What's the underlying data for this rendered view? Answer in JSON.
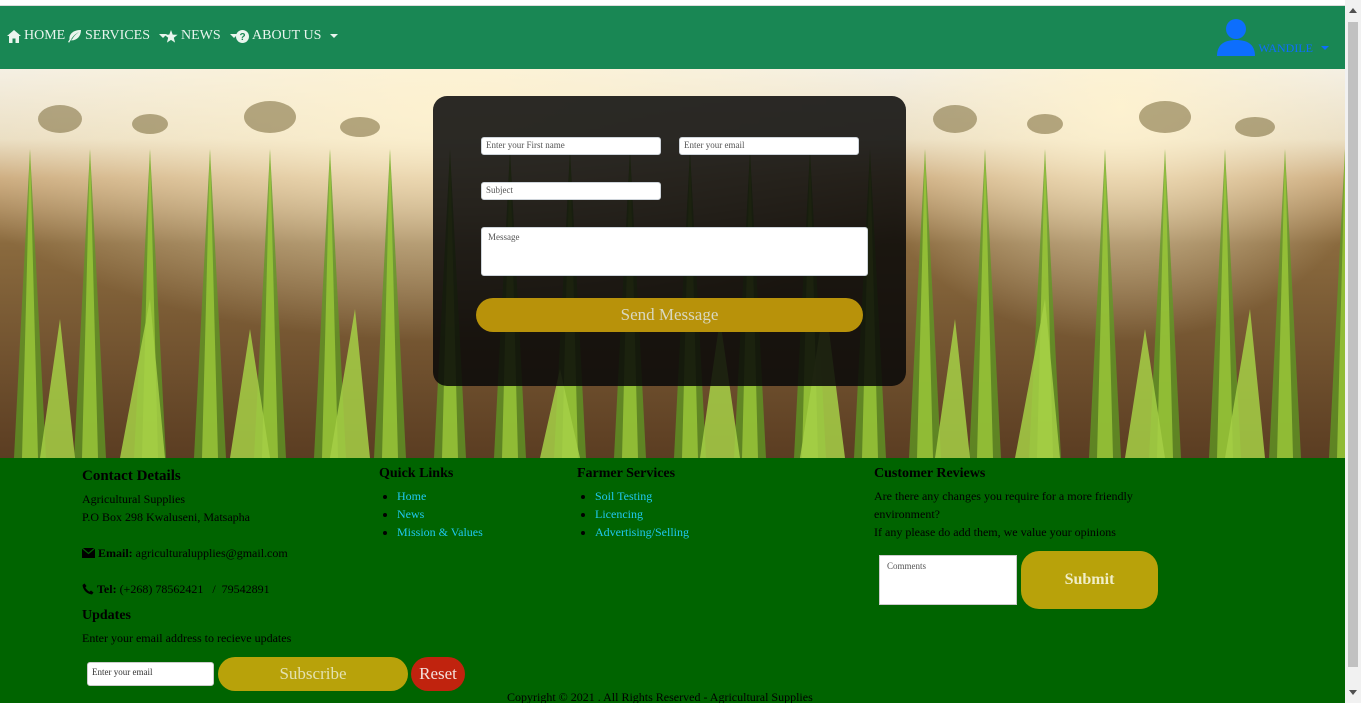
{
  "nav": {
    "items": [
      {
        "label": "HOME",
        "icon": "home-icon"
      },
      {
        "label": "SERVICES",
        "icon": "leaf-icon"
      },
      {
        "label": "NEWS",
        "icon": "star-icon"
      },
      {
        "label": "ABOUT US",
        "icon": "question-circle-icon"
      }
    ],
    "user": {
      "name": "WANDILE",
      "icon": "user-icon"
    }
  },
  "contact_form": {
    "first_name_placeholder": "Enter your First name",
    "email_placeholder": "Enter your email",
    "subject_placeholder": "Subject",
    "message_placeholder": "Message",
    "send_label": "Send Message"
  },
  "footer": {
    "contact": {
      "title": "Contact Details",
      "line1": "Agricultural Supplies",
      "line2": "P.O Box 298 Kwaluseni, Matsapha",
      "email_label": "Email:",
      "email": "agriculturalupplies@gmail.com",
      "tel_label": "Tel:",
      "tel": "(+268) 78562421   /  79542891"
    },
    "updates": {
      "title": "Updates",
      "text": "Enter your email address to recieve updates",
      "email_placeholder": "Enter your email",
      "subscribe_label": "Subscribe",
      "reset_label": "Reset"
    },
    "quick_links": {
      "title": "Quick Links",
      "items": [
        "Home",
        "News",
        "Mission & Values"
      ]
    },
    "farmer_services": {
      "title": "Farmer Services",
      "items": [
        "Soil Testing",
        "Licencing",
        "Advertising/Selling"
      ]
    },
    "reviews": {
      "title": "Customer Reviews",
      "text1": "Are there any changes you require for a more friendly environment?",
      "text2": "If any please do add them, we value your opinions",
      "comments_placeholder": "Comments",
      "submit_label": "Submit"
    },
    "copyright": "Copyright © 2021 . All Rights Reserved  -  Agricultural Supplies"
  },
  "colors": {
    "nav_bg": "#198754",
    "footer_bg": "#006400",
    "link": "#20c8f0",
    "gold_button": "#b8a20a",
    "reset_button": "#c0230e",
    "user_blue": "#0d6efd"
  }
}
